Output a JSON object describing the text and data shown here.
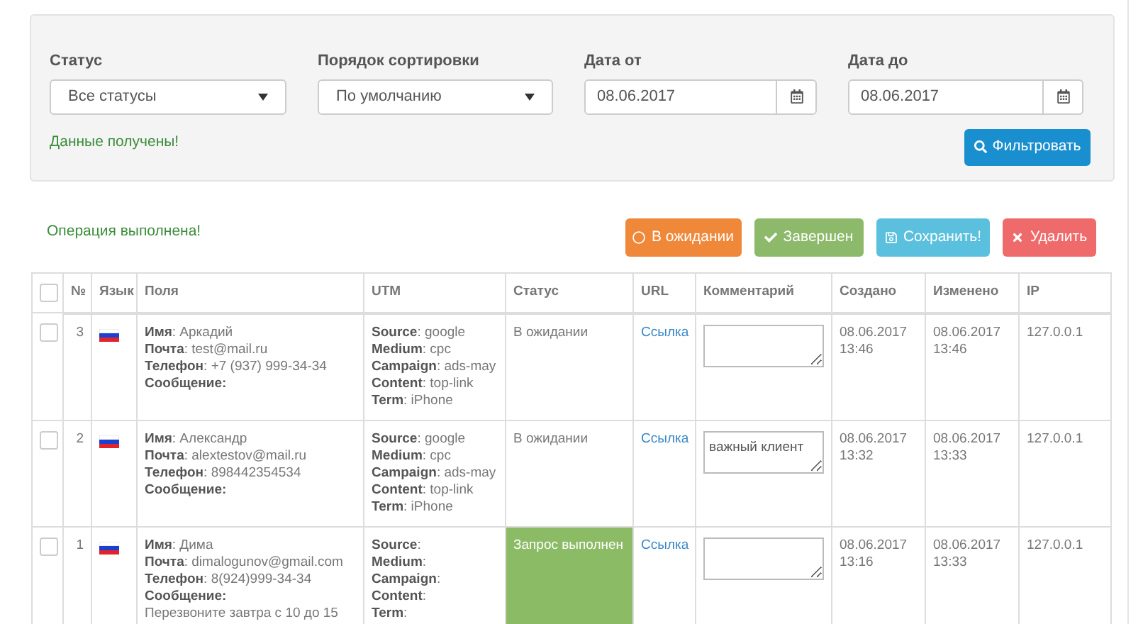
{
  "filters": {
    "fields": [
      {
        "kind": "select",
        "label": "Статус",
        "value": "Все статусы"
      },
      {
        "kind": "select",
        "label": "Порядок сортировки",
        "value": "По умолчанию"
      },
      {
        "kind": "date",
        "label": "Дата от",
        "value": "08.06.2017"
      },
      {
        "kind": "date",
        "label": "Дата до",
        "value": "08.06.2017"
      }
    ],
    "message": "Данные получены!",
    "button": "Фильтровать"
  },
  "operation_message": "Операция выполнена!",
  "actions": [
    {
      "kind": "pending",
      "label": "В ожидании"
    },
    {
      "kind": "done",
      "label": "Завершен"
    },
    {
      "kind": "save",
      "label": "Сохранить!"
    },
    {
      "kind": "delete",
      "label": "Удалить"
    }
  ],
  "table": {
    "columns": [
      "№",
      "Язык",
      "Поля",
      "UTM",
      "Статус",
      "URL",
      "Комментарий",
      "Создано",
      "Изменено",
      "IP"
    ],
    "header_checked": false,
    "rows": [
      {
        "checked": false,
        "number": "3",
        "fields": [
          "**Имя**: Аркадий",
          "**Почта**: test@mail.ru",
          "**Телефон**: +7 (937) 999-34-34",
          "**Сообщение:**"
        ],
        "message": "",
        "utm": [
          "**Source**: google",
          "**Medium**: cpc",
          "**Campaign**: ads-may",
          "**Content**: top-link",
          "**Term**: iPhone"
        ],
        "status": {
          "kind": "pending",
          "text": "В ожидании"
        },
        "url": "Ссылка",
        "comment": "",
        "created": [
          "08.06.2017",
          "13:46"
        ],
        "modified": [
          "08.06.2017",
          "13:46"
        ],
        "ip": "127.0.0.1"
      },
      {
        "checked": false,
        "number": "2",
        "fields": [
          "**Имя**: Александр",
          "**Почта**: alextestov@mail.ru",
          "**Телефон**: 898442354534",
          "**Сообщение:**"
        ],
        "message": "",
        "utm": [
          "**Source**: google",
          "**Medium**: cpc",
          "**Campaign**: ads-may",
          "**Content**: top-link",
          "**Term**: iPhone"
        ],
        "status": {
          "kind": "pending",
          "text": "В ожидании"
        },
        "url": "Ссылка",
        "comment": "важный клиент",
        "created": [
          "08.06.2017",
          "13:32"
        ],
        "modified": [
          "08.06.2017",
          "13:33"
        ],
        "ip": "127.0.0.1"
      },
      {
        "checked": false,
        "number": "1",
        "fields": [
          "**Имя**: Дима",
          "**Почта**: dimalogunov@gmail.com",
          "**Телефон**: 8(924)999-34-34",
          "**Сообщение:**"
        ],
        "message": "Перезвоните завтра с 10 до 15",
        "utm": [
          "**Source**:",
          "**Medium**:",
          "**Campaign**:",
          "**Content**:",
          "**Term**:"
        ],
        "status": {
          "kind": "done",
          "text": "Запрос выполнен"
        },
        "url": "Ссылка",
        "comment": "",
        "created": [
          "08.06.2017",
          "13:16"
        ],
        "modified": [
          "08.06.2017",
          "13:33"
        ],
        "ip": "127.0.0.1"
      }
    ]
  }
}
